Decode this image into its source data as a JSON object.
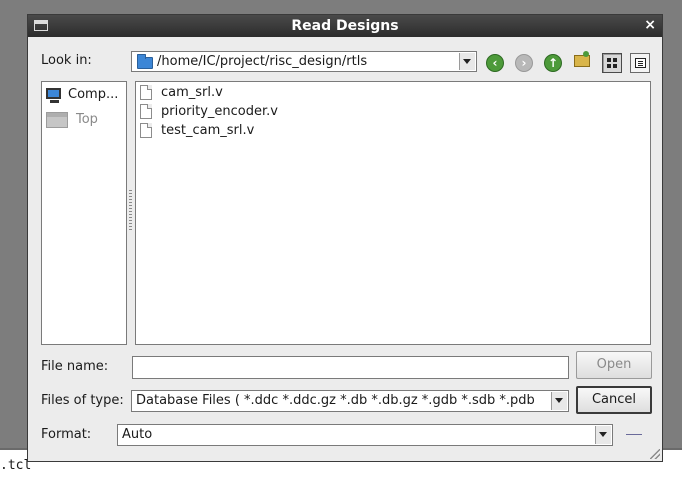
{
  "dialog": {
    "title": "Read Designs",
    "close_glyph": "×"
  },
  "look_in": {
    "label": "Look in:",
    "path": "/home/IC/project/risc_design/rtls"
  },
  "toolbar": {
    "back_icon": "back-arrow-icon",
    "forward_icon": "forward-arrow-icon",
    "up_icon": "up-arrow-icon",
    "new_folder_icon": "new-folder-icon",
    "icon_view": "icon-view-icon",
    "list_view": "list-view-icon"
  },
  "sidebar": {
    "items": [
      {
        "label": "Comp...",
        "icon": "computer-icon"
      },
      {
        "label": "Top",
        "icon": "drive-icon"
      }
    ]
  },
  "files": [
    {
      "name": "cam_srl.v"
    },
    {
      "name": "priority_encoder.v"
    },
    {
      "name": "test_cam_srl.v"
    }
  ],
  "file_name": {
    "label": "File name:",
    "value": ""
  },
  "files_of_type": {
    "label": "Files of type:",
    "value": "Database Files ( *.ddc *.ddc.gz *.db *.db.gz *.gdb *.sdb *.pdb"
  },
  "format": {
    "label": "Format:",
    "value": "Auto"
  },
  "buttons": {
    "open": "Open",
    "cancel": "Cancel"
  },
  "background": {
    "terminal_text": ".tcl"
  },
  "colors": {
    "titlebar": "#2c2c2c",
    "accent_blue": "#3c86d6",
    "nav_green": "#4d9a3a"
  }
}
